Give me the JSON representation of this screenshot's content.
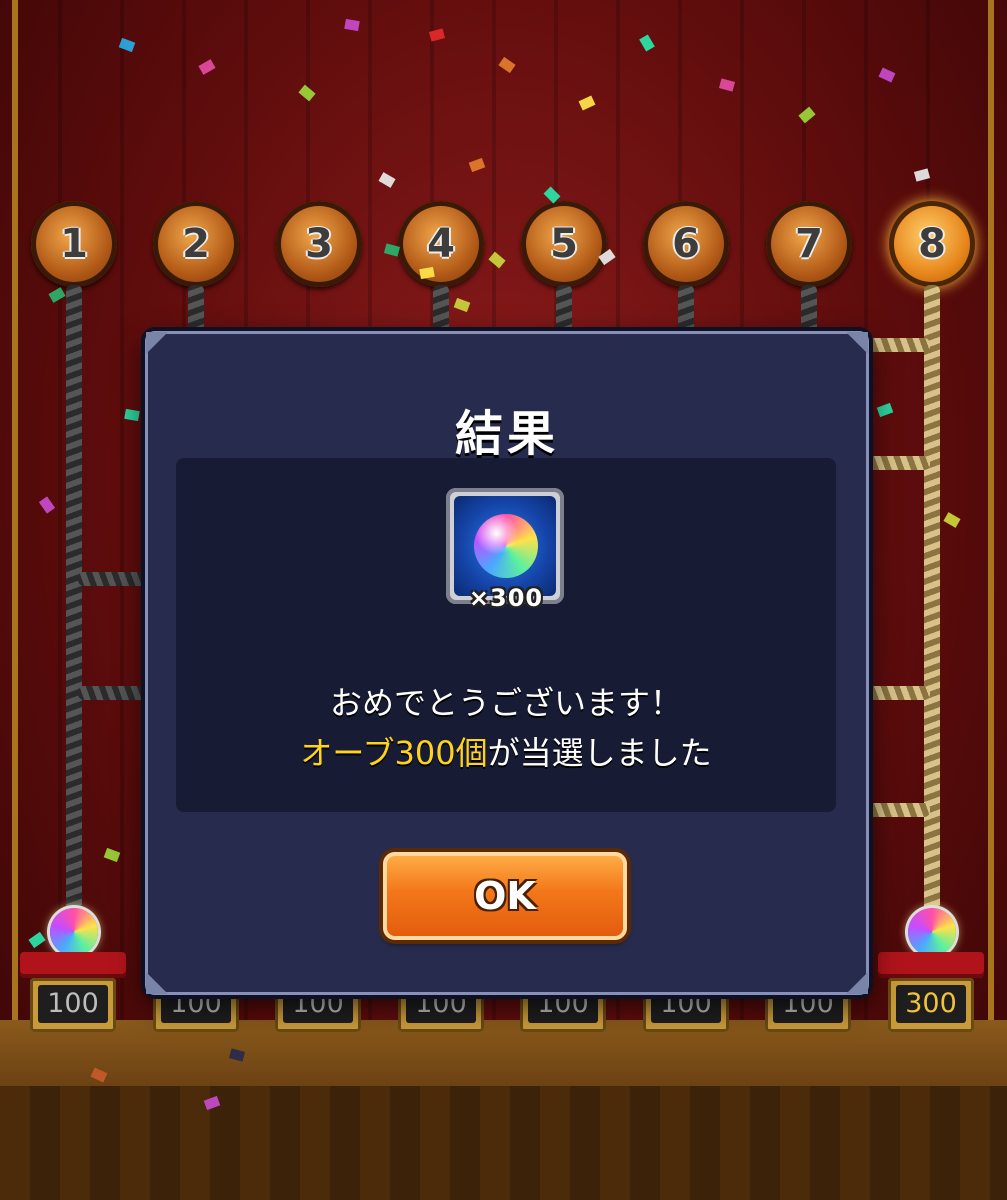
{
  "board": {
    "numbers": [
      "1",
      "2",
      "3",
      "4",
      "5",
      "6",
      "7",
      "8"
    ],
    "active_lane": "8",
    "prize_values": [
      "100",
      "100",
      "100",
      "100",
      "100",
      "100",
      "100",
      "300"
    ]
  },
  "dialog": {
    "title": "結果",
    "reward": {
      "icon": "rainbow-orb-icon",
      "quantity": "×300"
    },
    "message_line1": "おめでとうございます！",
    "message_line2_highlight": "オーブ300個",
    "message_line2_rest": "が当選しました",
    "ok_label": "OK"
  },
  "colors": {
    "dialog_bg": "#272c4e",
    "content_bg": "#171b33",
    "highlight_text": "#ffd21e",
    "ok_button": "#f3771a"
  }
}
